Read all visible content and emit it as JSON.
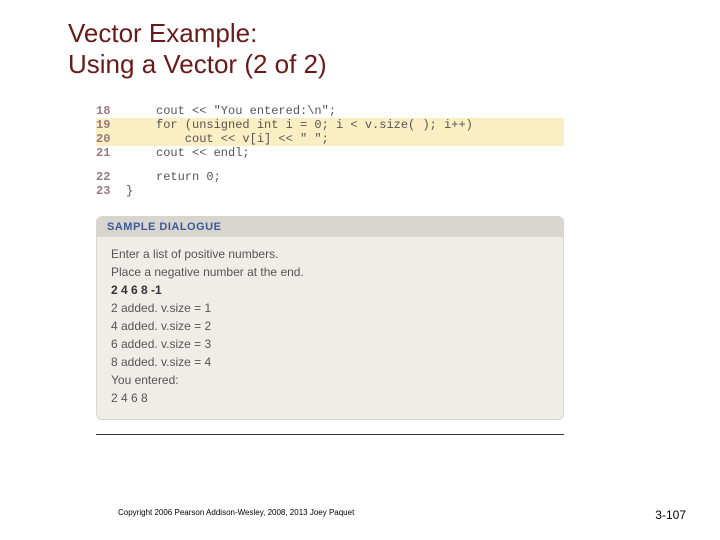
{
  "title_line1": "Vector Example:",
  "title_line2": "Using a Vector (2 of 2)",
  "code": {
    "l18": {
      "ln": "18",
      "text": "cout << \"You entered:\\n\";"
    },
    "l19": {
      "ln": "19",
      "text": "for (unsigned int i = 0; i < v.size( ); i++)"
    },
    "l20": {
      "ln": "20",
      "text": "    cout << v[i] << \" \";"
    },
    "l21": {
      "ln": "21",
      "text": "cout << endl;"
    },
    "l22": {
      "ln": "22",
      "text": "return 0;"
    },
    "l23": {
      "ln": "23",
      "brace": "}"
    }
  },
  "dialogue": {
    "header": "SAMPLE DIALOGUE",
    "prompt1": "Enter a list of positive numbers.",
    "prompt2": "Place a negative number at the end.",
    "input": "2 4 6 8 -1",
    "r1": "2 added. v.size = 1",
    "r2": "4 added. v.size = 2",
    "r3": "6 added. v.size = 3",
    "r4": "8 added. v.size = 4",
    "r5": "You entered:",
    "r6": "2 4 6 8"
  },
  "footer": {
    "copyright": "Copyright 2006 Pearson Addison-Wesley, 2008, 2013 Joey Paquet",
    "page": "3-107"
  }
}
